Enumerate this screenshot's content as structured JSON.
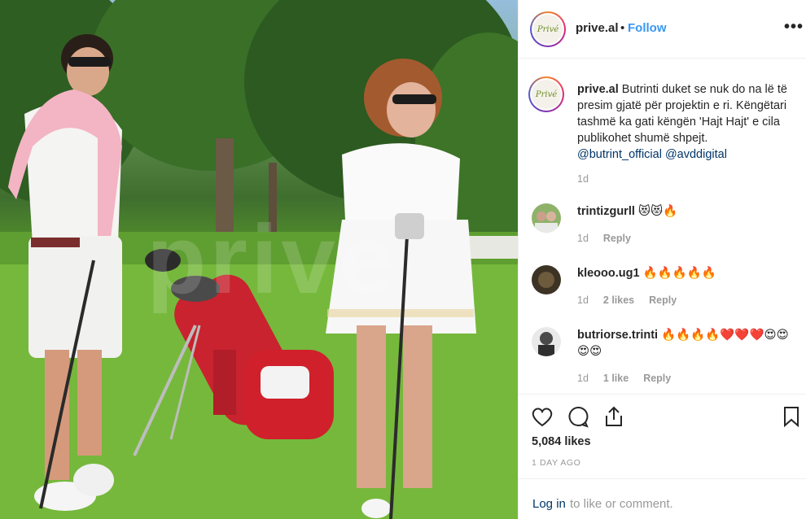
{
  "post": {
    "photo_alt": "Two people posing with golf clubs on a lawn",
    "watermark": "prive"
  },
  "header": {
    "avatar_text": "Privé",
    "username": "prive.al",
    "separator": "•",
    "follow_label": "Follow",
    "more_label": "•••"
  },
  "caption": {
    "avatar_text": "Privé",
    "username": "prive.al",
    "text": " Butrinti duket se nuk do na lë të presim gjatë për projektin e ri. Këngëtari tashmë ka gati këngën 'Hajt Hajt' e cila publikohet shumë shpejt. ",
    "mention1": "@butrint_official",
    "mention2": "@avddigital",
    "time": "1d"
  },
  "comments": [
    {
      "username": "trintizgurll",
      "text": " 😻😻🔥",
      "time": "1d",
      "likes": "",
      "reply": "Reply"
    },
    {
      "username": "kleooo.ug1",
      "text": " 🔥🔥🔥🔥🔥",
      "time": "1d",
      "likes": "2 likes",
      "reply": "Reply"
    },
    {
      "username": "butriorse.trinti",
      "text": " 🔥🔥🔥🔥❤️❤️❤️😍😍😍😍",
      "time": "1d",
      "likes": "1 like",
      "reply": "Reply"
    }
  ],
  "actions": {
    "likes": "5,084 likes",
    "age": "1 DAY AGO"
  },
  "login": {
    "link": "Log in",
    "rest": " to like or comment."
  },
  "colors": {
    "accent": "#3897f0",
    "link": "#003569",
    "muted": "#999999"
  }
}
